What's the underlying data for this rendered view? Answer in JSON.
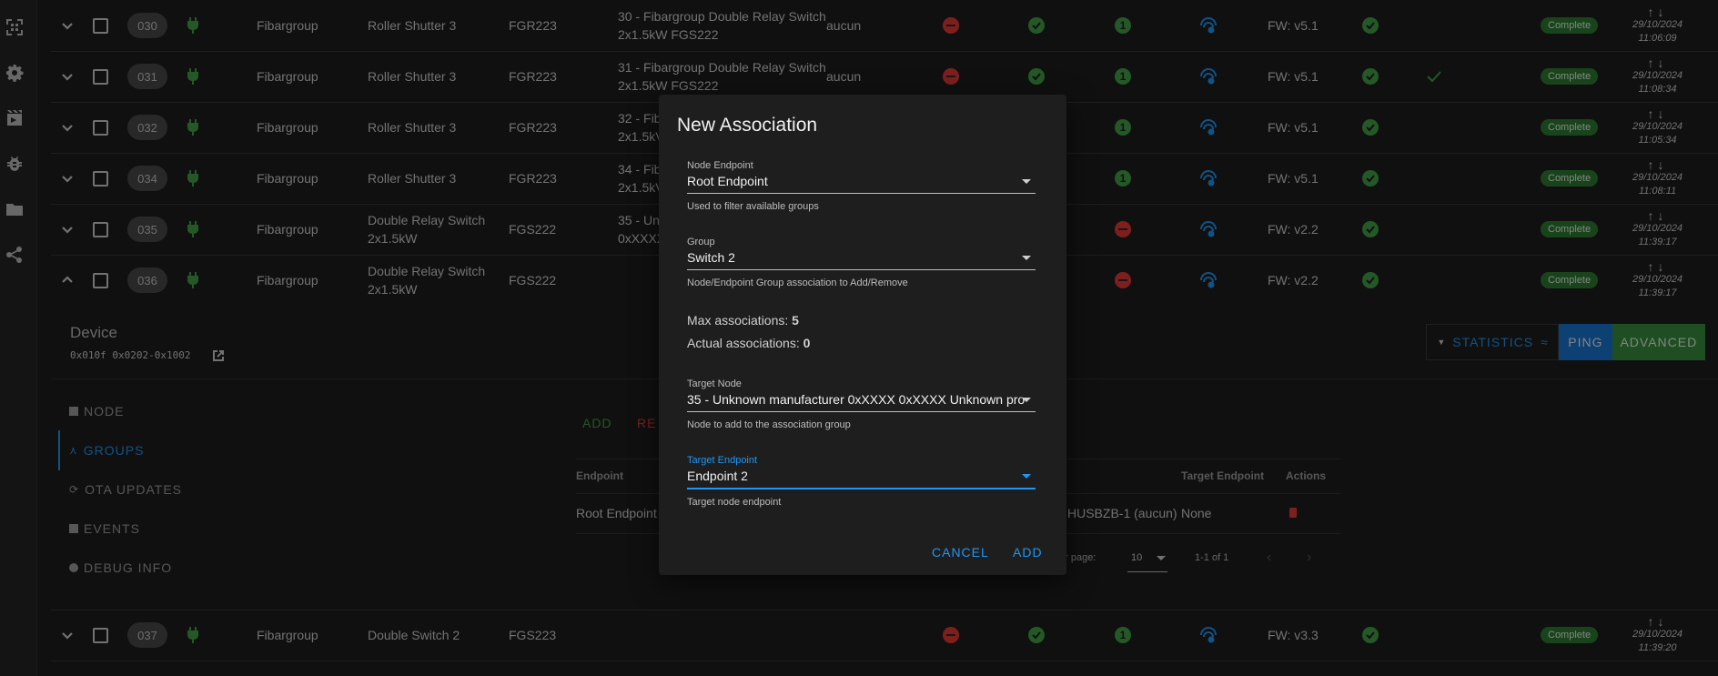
{
  "rows_top": [
    {
      "id": "030",
      "manufacturer": "Fibargroup",
      "product": "Roller Shutter 3",
      "code": "FGR223",
      "assoc_line1": "30 - Fibargroup Double Relay Switch",
      "assoc_line2": "2x1.5kW FGS222",
      "zone": "aucun",
      "fw": "FW: v5.1",
      "status": "Complete",
      "date": "29/10/2024",
      "time": "11:06:09"
    },
    {
      "id": "031",
      "manufacturer": "Fibargroup",
      "product": "Roller Shutter 3",
      "code": "FGR223",
      "assoc_line1": "31 - Fibargroup Double Relay Switch",
      "assoc_line2": "2x1.5kW FGS222",
      "zone": "aucun",
      "fw": "FW: v5.1",
      "status": "Complete",
      "date": "29/10/2024",
      "time": "11:08:34"
    },
    {
      "id": "032",
      "manufacturer": "Fibargroup",
      "product": "Roller Shutter 3",
      "code": "FGR223",
      "assoc_line1": "32 - Fib",
      "assoc_line2": "2x1.5kV",
      "zone": "",
      "fw": "FW: v5.1",
      "status": "Complete",
      "date": "29/10/2024",
      "time": "11:05:34"
    },
    {
      "id": "034",
      "manufacturer": "Fibargroup",
      "product": "Roller Shutter 3",
      "code": "FGR223",
      "assoc_line1": "34 - Fib",
      "assoc_line2": "2x1.5kV",
      "zone": "",
      "fw": "FW: v5.1",
      "status": "Complete",
      "date": "29/10/2024",
      "time": "11:08:11"
    },
    {
      "id": "035",
      "manufacturer": "Fibargroup",
      "product": "Double Relay Switch",
      "product2": "2x1.5kW",
      "code": "FGS222",
      "assoc_line1": "35 - Unl",
      "assoc_line2": "0xXXXX",
      "zone": "",
      "fw": "FW: v2.2",
      "status": "Complete",
      "date": "29/10/2024",
      "time": "11:39:17"
    },
    {
      "id": "036",
      "manufacturer": "Fibargroup",
      "product": "Double Relay Switch",
      "product2": "2x1.5kW",
      "code": "FGS222",
      "assoc_line1": "",
      "assoc_line2": "",
      "zone": "",
      "fw": "FW: v2.2",
      "status": "Complete",
      "date": "29/10/2024",
      "time": "11:39:17"
    }
  ],
  "row_bottom": {
    "id": "037",
    "manufacturer": "Fibargroup",
    "product": "Double Switch 2",
    "code": "FGS223",
    "fw": "FW: v3.3",
    "status": "Complete",
    "date": "29/10/2024",
    "time": "11:39:20"
  },
  "device": {
    "title": "Device",
    "ids": "0x010f 0x0202-0x1002",
    "tabs": [
      "NODE",
      "GROUPS",
      "OTA UPDATES",
      "EVENTS",
      "DEBUG INFO"
    ],
    "actions": {
      "statistics": "STATISTICS",
      "ping": "PING",
      "advanced": "ADVANCED"
    },
    "group_actions": {
      "add": "ADD",
      "remove": "RE"
    },
    "table": {
      "col_endpoint": "Endpoint",
      "col_target_endpoint": "Target Endpoint",
      "col_actions": "Actions",
      "row_endpoint": "Root Endpoint",
      "row_node": "HUSBZB-1 (aucun)",
      "row_target_endpoint": "None"
    },
    "pagination": {
      "rows_label": "er page:",
      "rows_value": "10",
      "range": "1-1 of 1"
    }
  },
  "dialog": {
    "title": "New Association",
    "node_endpoint": {
      "label": "Node Endpoint",
      "value": "Root Endpoint",
      "hint": "Used to filter available groups"
    },
    "group": {
      "label": "Group",
      "value": "Switch 2",
      "hint": "Node/Endpoint Group association to Add/Remove"
    },
    "max_label": "Max associations:",
    "max_value": "5",
    "actual_label": "Actual associations:",
    "actual_value": "0",
    "target_node": {
      "label": "Target Node",
      "value": "35 - Unknown manufacturer 0xXXXX 0xXXXX Unknown pro",
      "hint": "Node to add to the association group"
    },
    "target_endpoint": {
      "label": "Target Endpoint",
      "value": "Endpoint 2",
      "hint": "Target node endpoint"
    },
    "cancel": "CANCEL",
    "add": "ADD"
  },
  "colors": {
    "accent": "#2196f3",
    "green": "#43a047",
    "red": "#e53935",
    "badge": "#2e7d32"
  }
}
